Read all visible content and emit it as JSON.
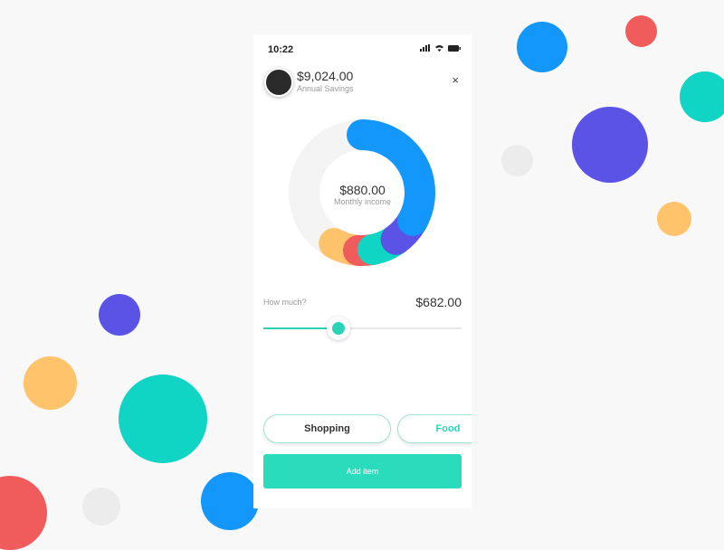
{
  "status": {
    "time": "10:22"
  },
  "header": {
    "amount": "$9,024.00",
    "label": "Annual Savings",
    "close": "×"
  },
  "chart": {
    "amount": "$880.00",
    "label": "Monthly income"
  },
  "chart_data": {
    "type": "pie",
    "title": "Monthly income",
    "categories": [
      "Remaining",
      "Blue",
      "Purple",
      "Teal",
      "Red",
      "Yellow"
    ],
    "values": [
      42,
      33,
      7,
      7,
      4,
      7
    ],
    "colors": [
      "#f4f4f4",
      "#1497fb",
      "#5b52e6",
      "#10d4c4",
      "#f05b5b",
      "#ffc46b"
    ]
  },
  "slider": {
    "label": "How much?",
    "amount": "$682.00",
    "value_fraction": 0.38
  },
  "chips": [
    {
      "label": "Shopping",
      "color": "#333333"
    },
    {
      "label": "Food",
      "color": "#2bd4b6"
    }
  ],
  "add_button": "Add item"
}
